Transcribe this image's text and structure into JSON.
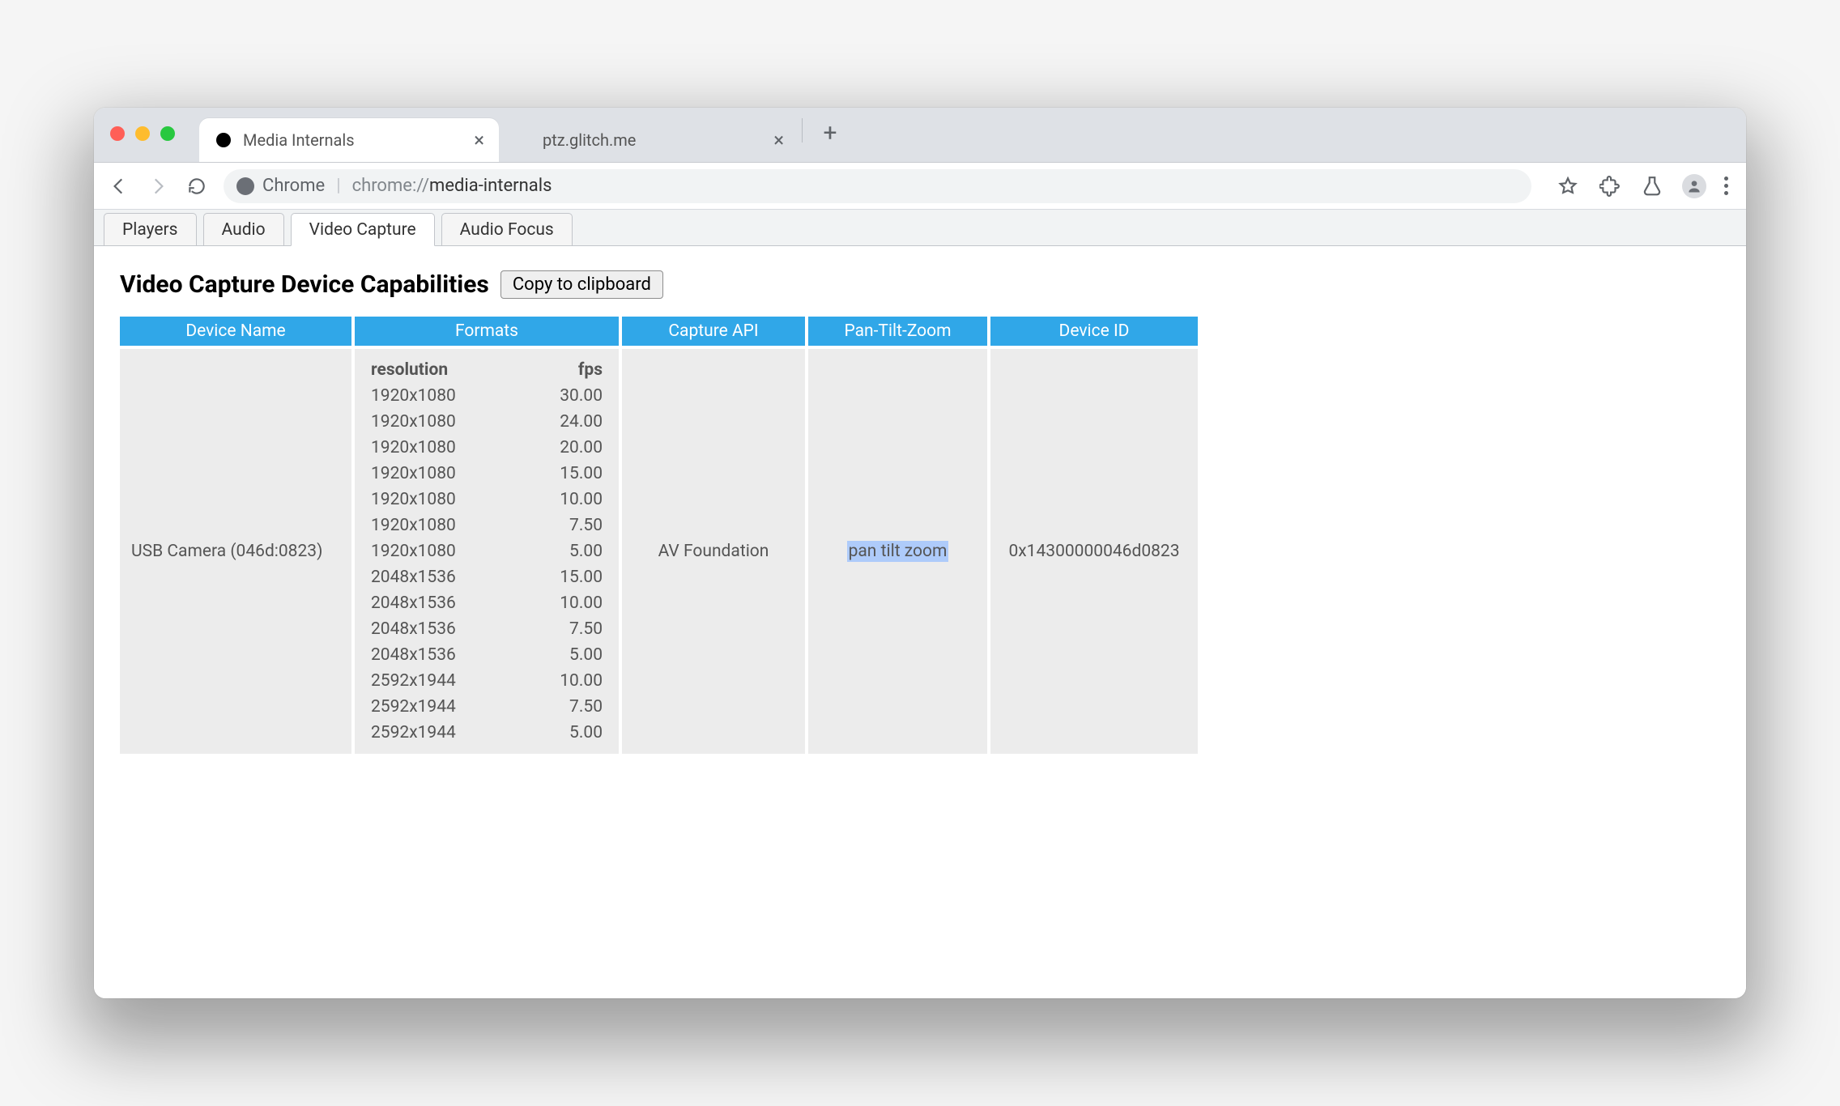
{
  "browser": {
    "tabs": [
      {
        "title": "Media Internals",
        "active": true
      },
      {
        "title": "ptz.glitch.me",
        "active": false
      }
    ],
    "chip": "Chrome",
    "url_prefix": "chrome://",
    "url_suffix": "media-internals"
  },
  "subtabs": {
    "items": [
      "Players",
      "Audio",
      "Video Capture",
      "Audio Focus"
    ],
    "active": 2
  },
  "page": {
    "heading": "Video Capture Device Capabilities",
    "copy_label": "Copy to clipboard"
  },
  "table": {
    "columns": [
      "Device Name",
      "Formats",
      "Capture API",
      "Pan-Tilt-Zoom",
      "Device ID"
    ],
    "formats_header": {
      "resolution": "resolution",
      "fps": "fps"
    },
    "row": {
      "device_name": "USB Camera (046d:0823)",
      "capture_api": "AV Foundation",
      "ptz": "pan tilt zoom",
      "device_id": "0x14300000046d0823",
      "formats": [
        {
          "res": "1920x1080",
          "fps": "30.00"
        },
        {
          "res": "1920x1080",
          "fps": "24.00"
        },
        {
          "res": "1920x1080",
          "fps": "20.00"
        },
        {
          "res": "1920x1080",
          "fps": "15.00"
        },
        {
          "res": "1920x1080",
          "fps": "10.00"
        },
        {
          "res": "1920x1080",
          "fps": "7.50"
        },
        {
          "res": "1920x1080",
          "fps": "5.00"
        },
        {
          "res": "2048x1536",
          "fps": "15.00"
        },
        {
          "res": "2048x1536",
          "fps": "10.00"
        },
        {
          "res": "2048x1536",
          "fps": "7.50"
        },
        {
          "res": "2048x1536",
          "fps": "5.00"
        },
        {
          "res": "2592x1944",
          "fps": "10.00"
        },
        {
          "res": "2592x1944",
          "fps": "7.50"
        },
        {
          "res": "2592x1944",
          "fps": "5.00"
        }
      ]
    }
  }
}
